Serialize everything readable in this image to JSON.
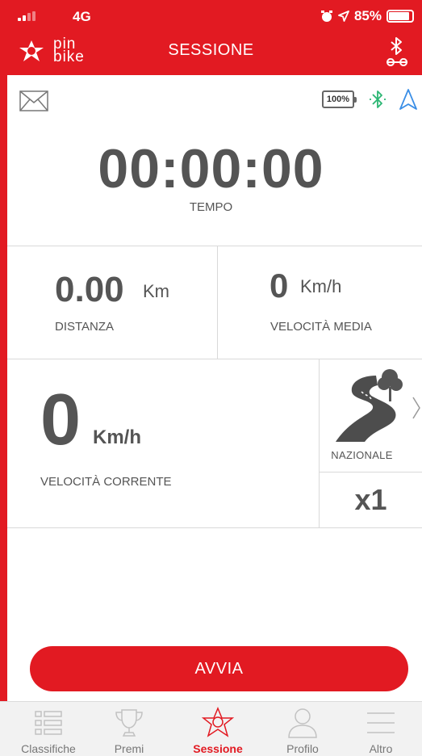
{
  "status_bar": {
    "network": "4G",
    "battery": "85%",
    "icons": [
      "signal-icon",
      "alarm-icon",
      "location-icon",
      "battery-icon"
    ]
  },
  "header": {
    "logo_text_line1": "pin",
    "logo_text_line2": "bike",
    "title": "SESSIONE",
    "right_icon": "bluetooth-wrench-icon"
  },
  "device_status": {
    "battery_text": "100%",
    "icons": [
      "mail-icon",
      "battery-icon",
      "bluetooth-icon",
      "navigation-arrow-icon"
    ]
  },
  "timer": {
    "value": "00:00:00",
    "label": "TEMPO"
  },
  "distance": {
    "value": "0.00",
    "unit": "Km",
    "label": "DISTANZA"
  },
  "avg_speed": {
    "value": "0",
    "unit": "Km/h",
    "label": "VELOCITÀ MEDIA"
  },
  "current_speed": {
    "value": "0",
    "unit": "Km/h",
    "label": "VELOCITÀ CORRENTE"
  },
  "route": {
    "label": "NAZIONALE",
    "multiplier": "x1",
    "icon": "winding-road-tree-icon"
  },
  "start_button": {
    "label": "AVVIA"
  },
  "tabs": [
    {
      "label": "Classifiche",
      "icon": "list-icon",
      "active": false
    },
    {
      "label": "Premi",
      "icon": "trophy-icon",
      "active": false
    },
    {
      "label": "Sessione",
      "icon": "star-icon",
      "active": true
    },
    {
      "label": "Profilo",
      "icon": "user-icon",
      "active": false
    },
    {
      "label": "Altro",
      "icon": "menu-icon",
      "active": false
    }
  ],
  "colors": {
    "brand_red": "#e21a22",
    "text_gray": "#555555",
    "bluetooth_green": "#2bb673",
    "nav_blue": "#3a8ee6"
  }
}
